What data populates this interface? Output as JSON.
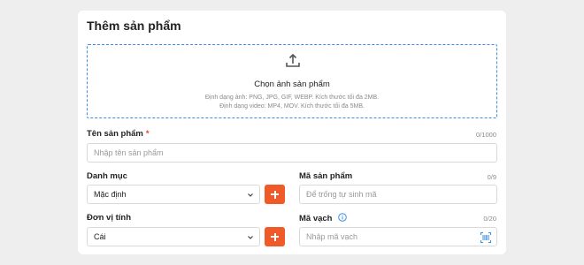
{
  "form": {
    "title": "Thêm sản phẩm",
    "upload": {
      "title": "Chọn ảnh sản phẩm",
      "image_hint": "Định dạng ảnh: PNG, JPG, GIF, WEBP. Kích thước tối đa 2MB.",
      "video_hint": "Định dạng video: MP4, MOV. Kích thước tối đa 5MB.",
      "icon": "upload-icon"
    },
    "product_name": {
      "label": "Tên sản phẩm",
      "required_mark": "*",
      "counter": "0/1000",
      "placeholder": "Nhập tên sản phẩm"
    },
    "category": {
      "label": "Danh mục",
      "value": "Mặc định"
    },
    "product_code": {
      "label": "Mã sản phẩm",
      "counter": "0/9",
      "placeholder": "Để trống tự sinh mã"
    },
    "unit": {
      "label": "Đơn vị tính",
      "value": "Cái"
    },
    "barcode": {
      "label": "Mã vạch",
      "counter": "0/20",
      "placeholder": "Nhập mã vạch",
      "icon": "barcode-scan-icon"
    }
  },
  "colors": {
    "accent": "#f05a28",
    "upload_border": "#3d8ee0",
    "info": "#3d8ee0",
    "required": "#e5442f"
  }
}
